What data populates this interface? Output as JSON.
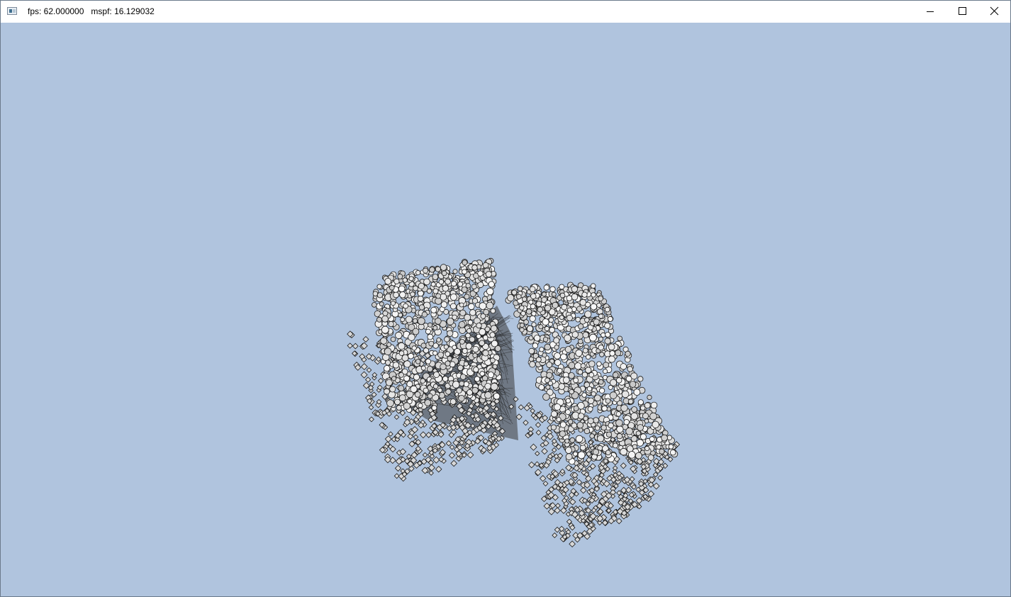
{
  "window": {
    "title": "fps: 62.000000   mspf: 16.129032",
    "app_icon": "window-app-icon",
    "controls": {
      "minimize_icon": "minimize-icon",
      "maximize_icon": "maximize-icon",
      "close_icon": "close-icon"
    }
  },
  "scene": {
    "background_color": "#b0c4de",
    "particle_color": "#d8d8d8",
    "outline_color": "#1a1a1a"
  }
}
